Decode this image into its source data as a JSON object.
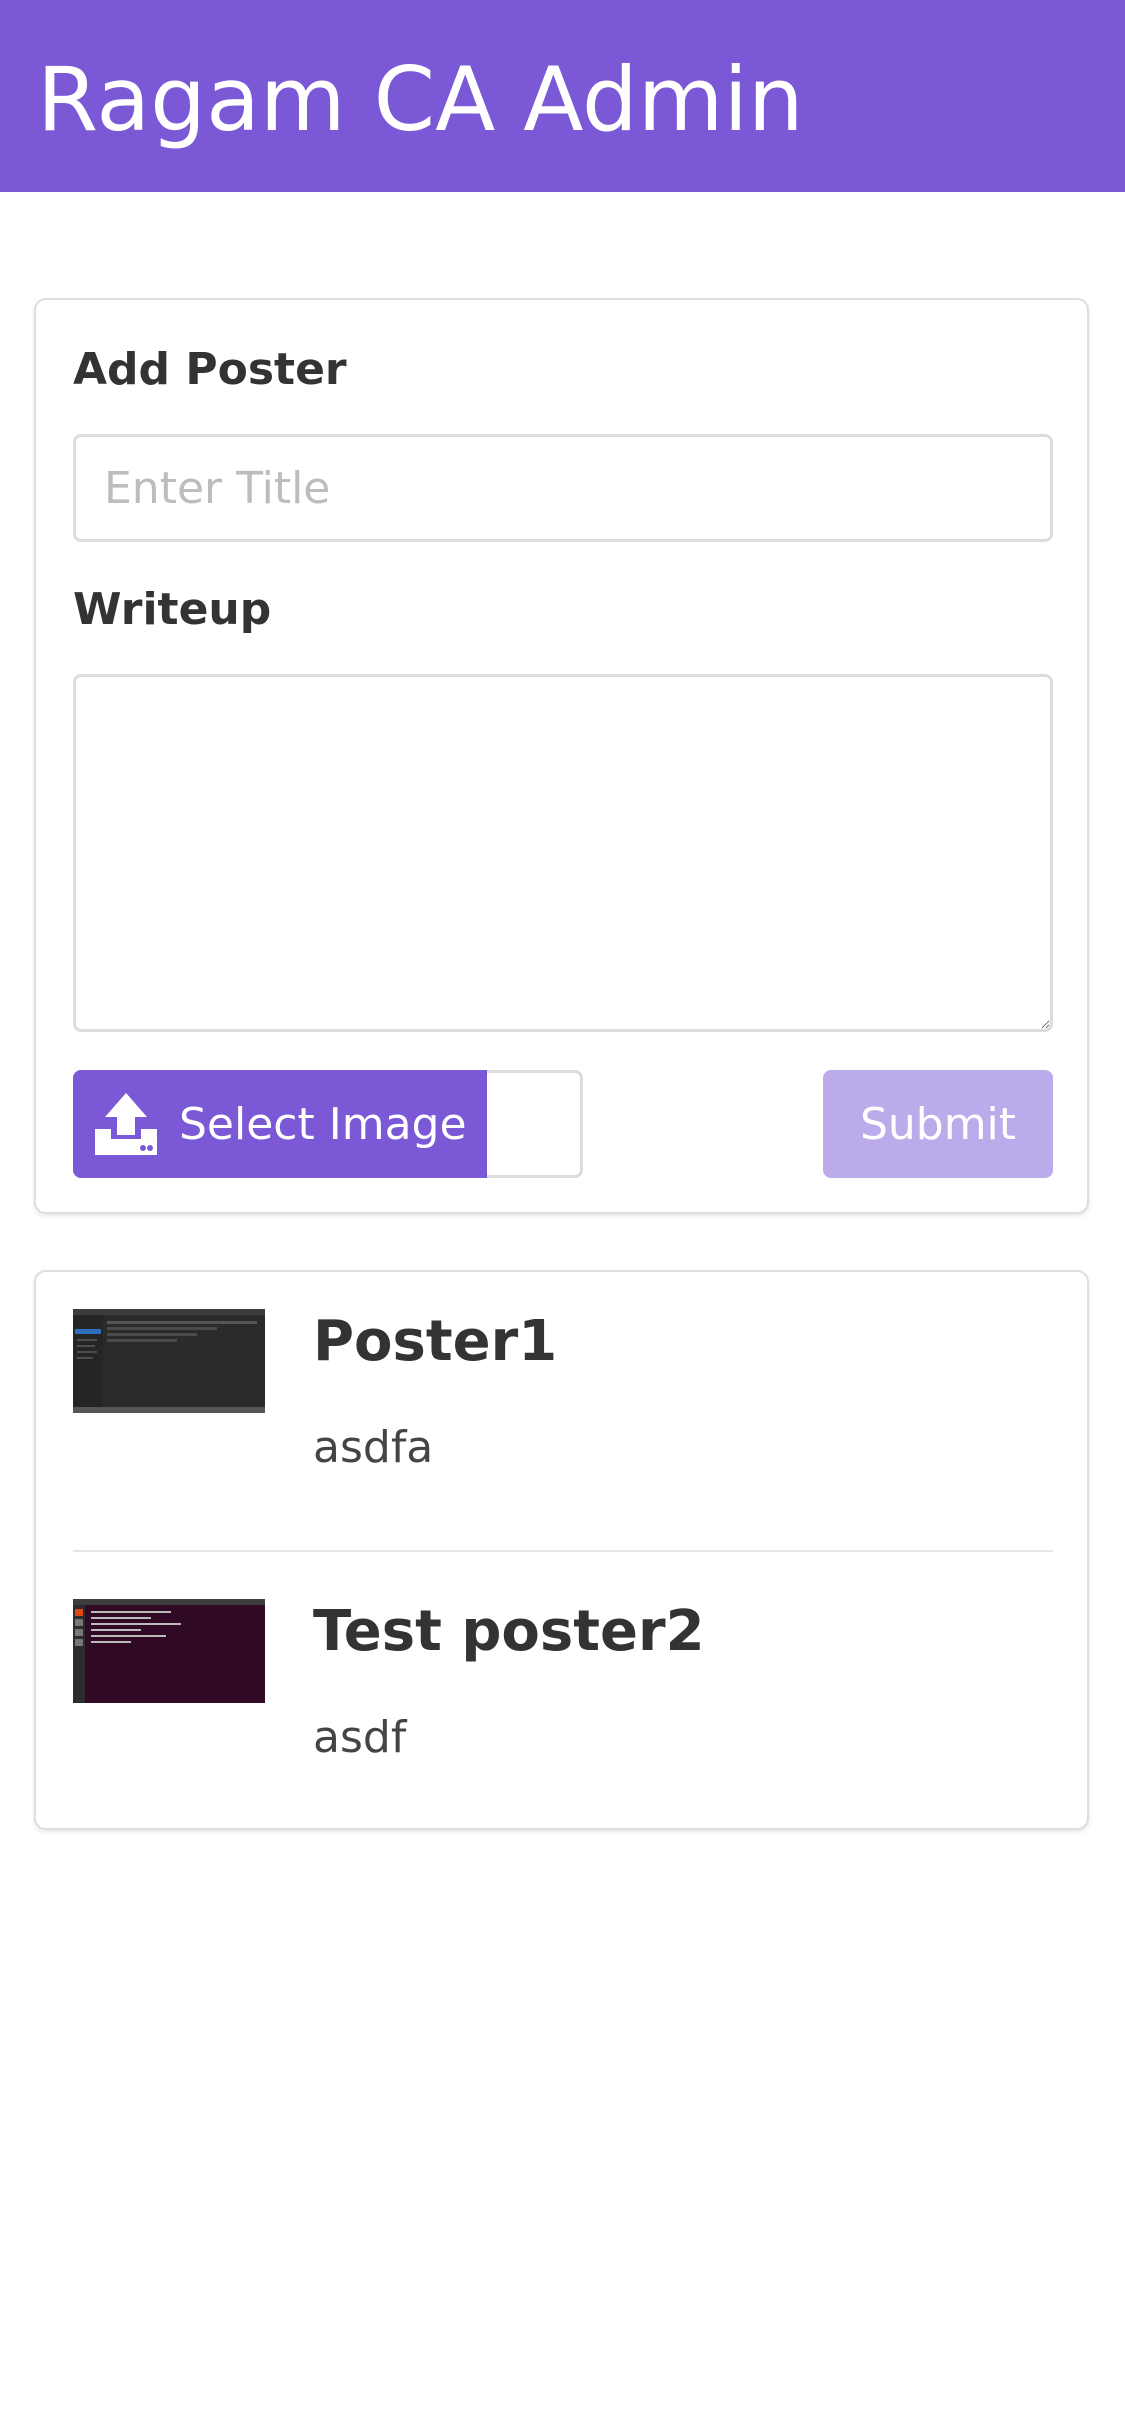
{
  "header": {
    "title": "Ragam CA Admin",
    "background_color": "#7b59d6"
  },
  "form": {
    "title_label": "Add Poster",
    "title_placeholder": "Enter Title",
    "title_value": "",
    "writeup_label": "Writeup",
    "writeup_value": "",
    "select_image_label": "Select Image",
    "select_image_icon": "upload-icon",
    "selected_file_name": "",
    "submit_label": "Submit",
    "submit_enabled": false,
    "accent_color": "#7b59d6",
    "submit_disabled_color": "#bcabea"
  },
  "posters": [
    {
      "title": "Poster1",
      "writeup": "asdfa",
      "thumbnail": "dark-editor-screenshot"
    },
    {
      "title": "Test poster2",
      "writeup": "asdf",
      "thumbnail": "terminal-screenshot"
    }
  ]
}
